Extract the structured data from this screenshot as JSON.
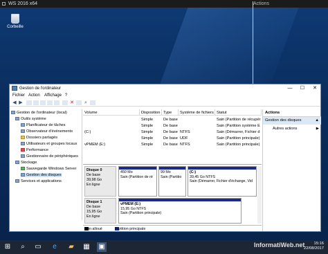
{
  "vm_bar": {
    "title": "WS 2016 x64",
    "actions": "Actions"
  },
  "desktop": {
    "recycle_bin": "Corbeille"
  },
  "window": {
    "title": "Gestion de l'ordinateur",
    "minimize": "—",
    "maximize": "☐",
    "close": "✕"
  },
  "menu": [
    "Fichier",
    "Action",
    "Affichage",
    "?"
  ],
  "tree": {
    "root": "Gestion de l'ordinateur (local)",
    "items": [
      {
        "label": "Outils système",
        "level": 1
      },
      {
        "label": "Planificateur de tâches",
        "level": 2
      },
      {
        "label": "Observateur d'événements",
        "level": 2
      },
      {
        "label": "Dossiers partagés",
        "level": 2
      },
      {
        "label": "Utilisateurs et groupes locaux",
        "level": 2
      },
      {
        "label": "Performance",
        "level": 2
      },
      {
        "label": "Gestionnaire de périphériques",
        "level": 2
      },
      {
        "label": "Stockage",
        "level": 1
      },
      {
        "label": "Sauvegarde Windows Server",
        "level": 2
      },
      {
        "label": "Gestion des disques",
        "level": 2
      },
      {
        "label": "Services et applications",
        "level": 1
      }
    ]
  },
  "volume_list": {
    "columns": [
      "Volume",
      "Disposition",
      "Type",
      "Système de fichiers",
      "Statut"
    ],
    "rows": [
      [
        "",
        "Simple",
        "De base",
        "",
        "Sain (Partition de récupér"
      ],
      [
        "",
        "Simple",
        "De base",
        "",
        "Sain (Partition système E"
      ],
      [
        "(C:)",
        "Simple",
        "De base",
        "NTFS",
        "Sain (Démarrer, Fichier d"
      ],
      [
        "",
        "Simple",
        "De base",
        "UDF",
        "Sain (Partition principale)"
      ],
      [
        "vPMEM (E:)",
        "Simple",
        "De base",
        "NTFS",
        "Sain (Partition principale)"
      ]
    ]
  },
  "disks": [
    {
      "name": "Disque 0",
      "type": "De base",
      "size": "39,98 Go",
      "state": "En ligne",
      "partitions": [
        {
          "name": "",
          "line1": "450 Mo",
          "line2": "Sain (Partition de ré"
        },
        {
          "name": "",
          "line1": "99 Mo",
          "line2": "Sain (Partitio"
        },
        {
          "name": "(C:)",
          "line1": "39,45 Go NTFS",
          "line2": "Sain (Démarrer, Fichier d'échange, Vid"
        }
      ]
    },
    {
      "name": "Disque 1",
      "type": "De base",
      "size": "15,95 Go",
      "state": "En ligne",
      "partitions": [
        {
          "name": "vPMEM (E:)",
          "line1": "15,95 Go NTFS",
          "line2": "Sain (Partition principale)"
        }
      ]
    }
  ],
  "legend": {
    "unallocated": "Non alloué",
    "primary": "Partition principale"
  },
  "actions": {
    "header": "Actions",
    "section": "Gestion des disques",
    "item": "Autres actions"
  },
  "taskbar": {
    "time": "15:16",
    "date": "22/08/2017"
  },
  "watermark": "InformatiWeb.net",
  "colors": {
    "desktop": "#0e3a74",
    "partition_bar": "#1b2a8c",
    "selection": "#cce4f7",
    "taskbar": "#1c2635"
  }
}
